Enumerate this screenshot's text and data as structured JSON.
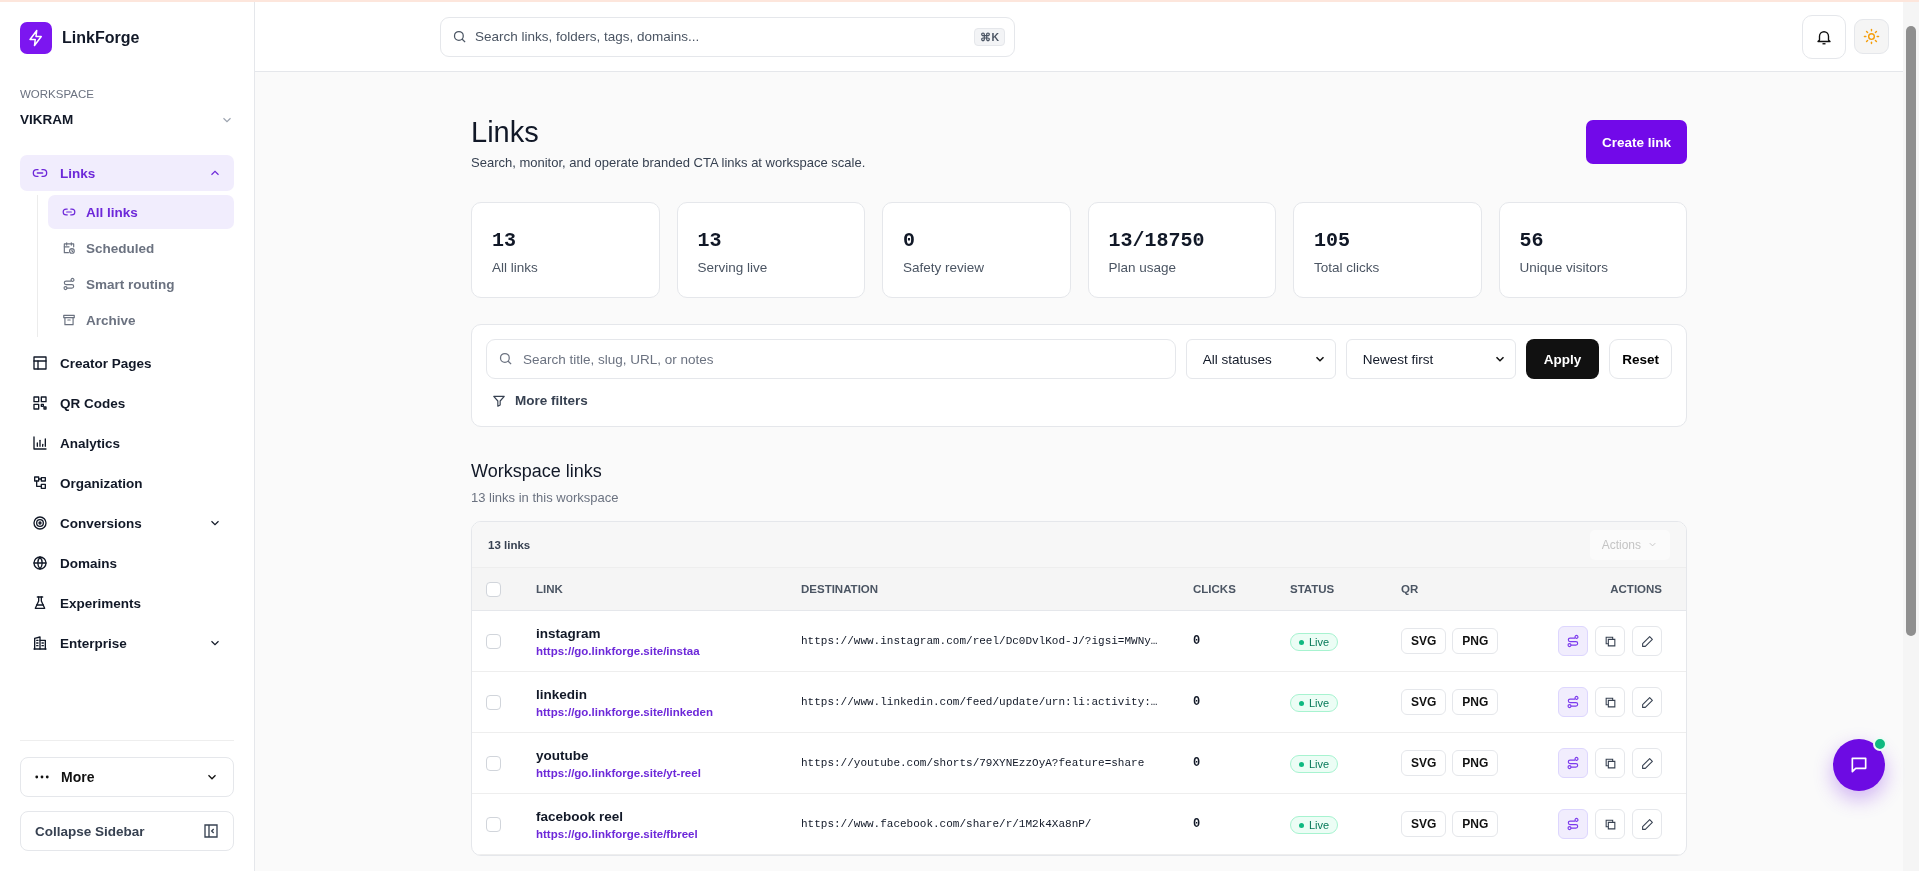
{
  "sidebar": {
    "brand": "LinkForge",
    "workspace_label": "WORKSPACE",
    "workspace": "VIKRAM",
    "nav": [
      {
        "label": "Links",
        "selected": true,
        "expanded": true,
        "children": [
          {
            "label": "All links",
            "selected": true
          },
          {
            "label": "Scheduled",
            "selected": false
          },
          {
            "label": "Smart routing",
            "selected": false
          },
          {
            "label": "Archive",
            "selected": false
          }
        ]
      },
      {
        "label": "Creator Pages",
        "selected": false
      },
      {
        "label": "QR Codes",
        "selected": false
      },
      {
        "label": "Analytics",
        "selected": false
      },
      {
        "label": "Organization",
        "selected": false
      },
      {
        "label": "Conversions",
        "selected": false,
        "expanded": false
      },
      {
        "label": "Domains",
        "selected": false
      },
      {
        "label": "Experiments",
        "selected": false
      },
      {
        "label": "Enterprise",
        "selected": false,
        "expanded": false
      }
    ],
    "more": "More",
    "collapse": "Collapse Sidebar"
  },
  "topbar": {
    "search_placeholder": "Search links, folders, tags, domains...",
    "shortcut": "⌘K"
  },
  "page": {
    "title": "Links",
    "subtitle": "Search, monitor, and operate branded CTA links at workspace scale.",
    "create_button": "Create link"
  },
  "stats": [
    {
      "value": "13",
      "label": "All links"
    },
    {
      "value": "13",
      "label": "Serving live"
    },
    {
      "value": "0",
      "label": "Safety review"
    },
    {
      "value": "13/18750",
      "label": "Plan usage"
    },
    {
      "value": "105",
      "label": "Total clicks"
    },
    {
      "value": "56",
      "label": "Unique visitors"
    }
  ],
  "filters": {
    "search_placeholder": "Search title, slug, URL, or notes",
    "status": "All statuses",
    "sort": "Newest first",
    "apply": "Apply",
    "reset": "Reset",
    "more_filters": "More filters"
  },
  "section": {
    "title": "Workspace links",
    "subtitle": "13 links in this workspace"
  },
  "table": {
    "count": "13 links",
    "select_all_checked": false,
    "actions_menu": {
      "label": "Actions",
      "disabled": true
    },
    "columns": [
      "LINK",
      "DESTINATION",
      "CLICKS",
      "STATUS",
      "QR",
      "ACTIONS"
    ],
    "rows": [
      {
        "checked": false,
        "title": "instagram",
        "short_url": "https://go.linkforge.site/instaa",
        "destination": "https://www.instagram.com/reel/Dc0DvlKod-J/?igsi=MWNy…",
        "clicks": "0",
        "status": "Live",
        "qr": [
          "SVG",
          "PNG"
        ]
      },
      {
        "checked": false,
        "title": "linkedin",
        "short_url": "https://go.linkforge.site/linkeden",
        "destination": "https://www.linkedin.com/feed/update/urn:li:activity:…",
        "clicks": "0",
        "status": "Live",
        "qr": [
          "SVG",
          "PNG"
        ]
      },
      {
        "checked": false,
        "title": "youtube",
        "short_url": "https://go.linkforge.site/yt-reel",
        "destination": "https://youtube.com/shorts/79XYNEzzOyA?feature=share",
        "clicks": "0",
        "status": "Live",
        "qr": [
          "SVG",
          "PNG"
        ]
      },
      {
        "checked": false,
        "title": "facebook reel",
        "short_url": "https://go.linkforge.site/fbreel",
        "destination": "https://www.facebook.com/share/r/1M2k4Xa8nP/",
        "clicks": "0",
        "status": "Live",
        "qr": [
          "SVG",
          "PNG"
        ]
      }
    ]
  }
}
